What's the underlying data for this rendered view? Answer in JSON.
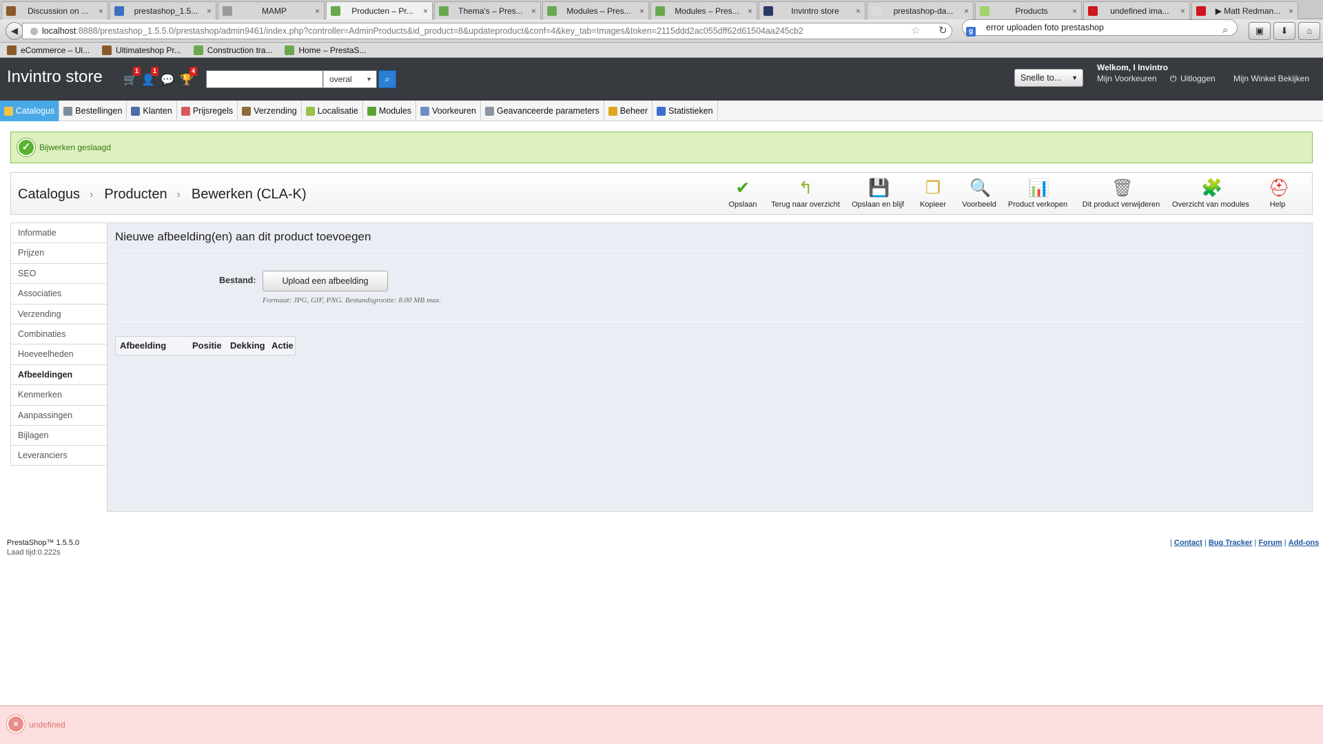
{
  "browser": {
    "tabs": [
      {
        "title": "Discussion on ...",
        "icon_color": "#8b5a2b",
        "icon": "forum-favicon"
      },
      {
        "title": "prestashop_1.5...",
        "icon_color": "#3b6fc2",
        "icon": "file-favicon"
      },
      {
        "title": "MAMP",
        "icon_color": "#999999",
        "icon": "globe-favicon"
      },
      {
        "title": "Producten – Pr...",
        "icon_color": "#6aa84f",
        "icon": "prestashop-favicon"
      },
      {
        "title": "Thema's – Pres...",
        "icon_color": "#6aa84f",
        "icon": "prestashop-favicon"
      },
      {
        "title": "Modules – Pres...",
        "icon_color": "#6aa84f",
        "icon": "prestashop-favicon"
      },
      {
        "title": "Modules – Pres...",
        "icon_color": "#6aa84f",
        "icon": "prestashop-favicon"
      },
      {
        "title": "Invintro store",
        "icon_color": "#2b3a67",
        "icon": "store-favicon"
      },
      {
        "title": "prestashop-da...",
        "icon_color": "#dddddd",
        "icon": "blank-favicon"
      },
      {
        "title": "Products",
        "icon_color": "#9fd36b",
        "icon": "prestashop-favicon"
      },
      {
        "title": "undefined ima...",
        "icon_color": "#cc181e",
        "icon": "youtube-favicon"
      },
      {
        "title": "▶ Matt Redman...",
        "icon_color": "#cc181e",
        "icon": "youtube-favicon"
      }
    ],
    "active_tab_index": 3,
    "tab_close": "×",
    "url_host": "localhost",
    "url_rest": ":8888/prestashop_1.5.5.0/prestashop/admin9461/index.php?controller=AdminProducts&id_product=8&updateproduct&conf=4&key_tab=Images&token=2115ddd2ac055dff62d61504aa245cb2",
    "search_value": "error uploaden foto prestashop",
    "search_engine_letter": "g",
    "back_glyph": "◀",
    "star_glyph": "☆",
    "reload_glyph": "↻",
    "mag_glyph": "⌕",
    "bookmarks": [
      {
        "label": "eCommerce – Ul...",
        "icon_color": "#8b5a2b"
      },
      {
        "label": "Ultimateshop Pr...",
        "icon_color": "#8b5a2b"
      },
      {
        "label": "Construction tra...",
        "icon_color": "#6aa84f"
      },
      {
        "label": "Home – PrestaS...",
        "icon_color": "#6aa84f"
      }
    ]
  },
  "header": {
    "store_name": "Invintro store",
    "notifications": [
      {
        "icon": "cart-icon",
        "glyph": "🛒",
        "count": "1"
      },
      {
        "icon": "customer-icon",
        "glyph": "👤",
        "count": "1"
      },
      {
        "icon": "messages-icon",
        "glyph": "💬",
        "count": ""
      },
      {
        "icon": "trophy-icon",
        "glyph": "🏆",
        "count": "4"
      }
    ],
    "search_placeholder": "",
    "search_scope": "overal",
    "quick_access": "Snelle to...",
    "welcome": "Welkom, I Invintro",
    "preferences": "Mijn Voorkeuren",
    "logout": "Uitloggen",
    "view_shop": "Mijn Winkel Bekijken",
    "colors": {
      "bg": "#373b40",
      "accent": "#2a7fd4"
    }
  },
  "menu": {
    "items": [
      {
        "label": "Catalogus",
        "icon_color": "#f3c443",
        "active": true
      },
      {
        "label": "Bestellingen",
        "icon_color": "#7d8d9c",
        "active": false
      },
      {
        "label": "Klanten",
        "icon_color": "#4a6ea8",
        "active": false
      },
      {
        "label": "Prijsregels",
        "icon_color": "#d65a5a",
        "active": false
      },
      {
        "label": "Verzending",
        "icon_color": "#8a6d3b",
        "active": false
      },
      {
        "label": "Localisatie",
        "icon_color": "#9ac14a",
        "active": false
      },
      {
        "label": "Modules",
        "icon_color": "#5aa532",
        "active": false
      },
      {
        "label": "Voorkeuren",
        "icon_color": "#6b8fc2",
        "active": false
      },
      {
        "label": "Geavanceerde parameters",
        "icon_color": "#8b93a1",
        "active": false
      },
      {
        "label": "Beheer",
        "icon_color": "#e0a820",
        "active": false
      },
      {
        "label": "Statistieken",
        "icon_color": "#3c6fcf",
        "active": false
      }
    ]
  },
  "success": {
    "text": "Bijwerken geslaagd",
    "icon": "✓",
    "color": "#5cb130"
  },
  "breadcrumb": {
    "level1": "Catalogus",
    "level2": "Producten",
    "level3": "Bewerken (CLA-K)",
    "sep": "›"
  },
  "toolbar": [
    {
      "label": "Opslaan",
      "icon": "save-check-icon",
      "glyph": "✔",
      "color": "#4aa82a"
    },
    {
      "label": "Terug naar overzicht",
      "icon": "back-arrow-icon",
      "glyph": "↰",
      "color": "#8fb42a"
    },
    {
      "label": "Opslaan en blijf",
      "icon": "floppy-icon",
      "glyph": "💾",
      "color": "#333333"
    },
    {
      "label": "Kopieer",
      "icon": "copy-icon",
      "glyph": "❐",
      "color": "#d9a928"
    },
    {
      "label": "Voorbeeld",
      "icon": "preview-icon",
      "glyph": "🔍",
      "color": "#6d7f92"
    },
    {
      "label": "Product verkopen",
      "icon": "sales-chart-icon",
      "glyph": "📊",
      "color": "#d9442c"
    },
    {
      "label": "Dit product verwijderen",
      "icon": "trash-icon",
      "glyph": "🗑",
      "color": "#777777"
    },
    {
      "label": "Overzicht van modules",
      "icon": "puzzle-icon",
      "glyph": "🧩",
      "color": "#4fae2f"
    },
    {
      "label": "Help",
      "icon": "lifebuoy-icon",
      "glyph": "⛑",
      "color": "#e0382c"
    }
  ],
  "product_tabs": [
    {
      "label": "Informatie",
      "active": false
    },
    {
      "label": "Prijzen",
      "active": false
    },
    {
      "label": "SEO",
      "active": false
    },
    {
      "label": "Associaties",
      "active": false
    },
    {
      "label": "Verzending",
      "active": false
    },
    {
      "label": "Combinaties",
      "active": false
    },
    {
      "label": "Hoeveelheden",
      "active": false
    },
    {
      "label": "Afbeeldingen",
      "active": true
    },
    {
      "label": "Kenmerken",
      "active": false
    },
    {
      "label": "Aanpassingen",
      "active": false
    },
    {
      "label": "Bijlagen",
      "active": false
    },
    {
      "label": "Leveranciers",
      "active": false
    }
  ],
  "panel": {
    "title": "Nieuwe afbeelding(en) aan dit product toevoegen",
    "file_label": "Bestand:",
    "upload_button": "Upload een afbeelding",
    "format_hint": "Formaat: JPG, GIF, PNG. Bestandsgrootte: 8.00 MB max.",
    "table_headers": [
      "Afbeelding",
      "Positie",
      "Dekking",
      "Actie"
    ]
  },
  "footer": {
    "version": "PrestaShop™ 1.5.5.0",
    "load_time": "Laad tijd:0.222s",
    "links": [
      "Contact",
      "Bug Tracker",
      "Forum",
      "Add-ons"
    ],
    "link_sep": "|"
  },
  "error": {
    "text": "undefined",
    "icon": "×",
    "color": "#e88c8c"
  }
}
